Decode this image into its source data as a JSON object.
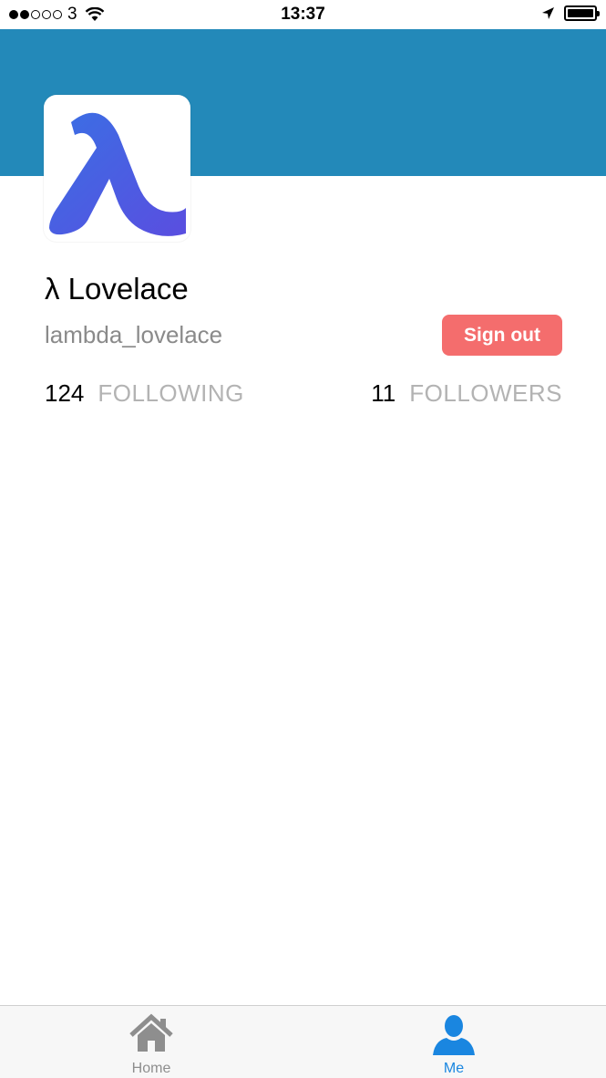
{
  "status_bar": {
    "carrier": "3",
    "time": "13:37",
    "signal_bars_filled": 2,
    "signal_bars_total": 5,
    "icons": [
      "signal-dots-icon",
      "wifi-icon",
      "location-arrow-icon",
      "battery-icon"
    ]
  },
  "colors": {
    "banner": "#2389b9",
    "sign_out_button": "#f46d6d",
    "active_tab": "#1a86e0",
    "inactive_tab": "#8e8e8e"
  },
  "profile": {
    "avatar_icon": "lambda-logo-icon",
    "display_name": "λ Lovelace",
    "username": "lambda_lovelace",
    "sign_out_label": "Sign out",
    "following_count": "124",
    "following_label": "FOLLOWING",
    "followers_count": "11",
    "followers_label": "FOLLOWERS"
  },
  "tab_bar": {
    "tabs": [
      {
        "label": "Home",
        "icon": "home-icon",
        "active": false
      },
      {
        "label": "Me",
        "icon": "person-icon",
        "active": true
      }
    ]
  }
}
